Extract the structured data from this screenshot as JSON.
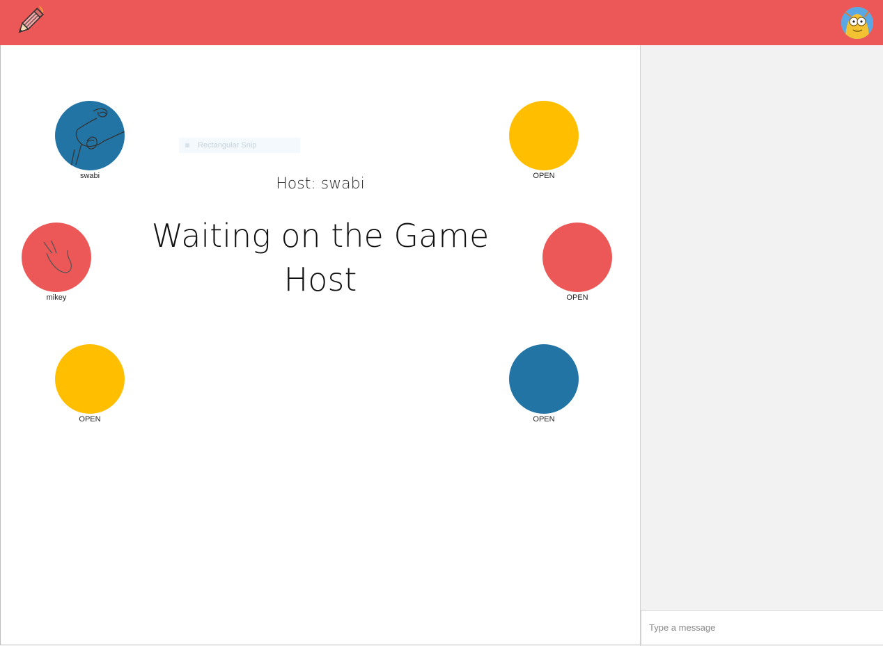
{
  "colors": {
    "header": "#ec5858",
    "red": "#ec5858",
    "yellow": "#ffbf00",
    "blue": "#2274a5"
  },
  "header": {
    "logo_icon": "pencil-logo-icon",
    "avatar_icon": "user-avatar-icon"
  },
  "lobby": {
    "host_text": "Host: swabi",
    "status_text": "Waiting on the Game Host",
    "ghost_overlay": "Rectangular Snip"
  },
  "seats": [
    {
      "label": "swabi",
      "color": "blue",
      "occupied": true
    },
    {
      "label": "OPEN",
      "color": "yellow",
      "occupied": false
    },
    {
      "label": "mikey",
      "color": "red",
      "occupied": true
    },
    {
      "label": "OPEN",
      "color": "red",
      "occupied": false
    },
    {
      "label": "OPEN",
      "color": "yellow",
      "occupied": false
    },
    {
      "label": "OPEN",
      "color": "blue",
      "occupied": false
    }
  ],
  "chat": {
    "input_placeholder": "Type a message"
  }
}
